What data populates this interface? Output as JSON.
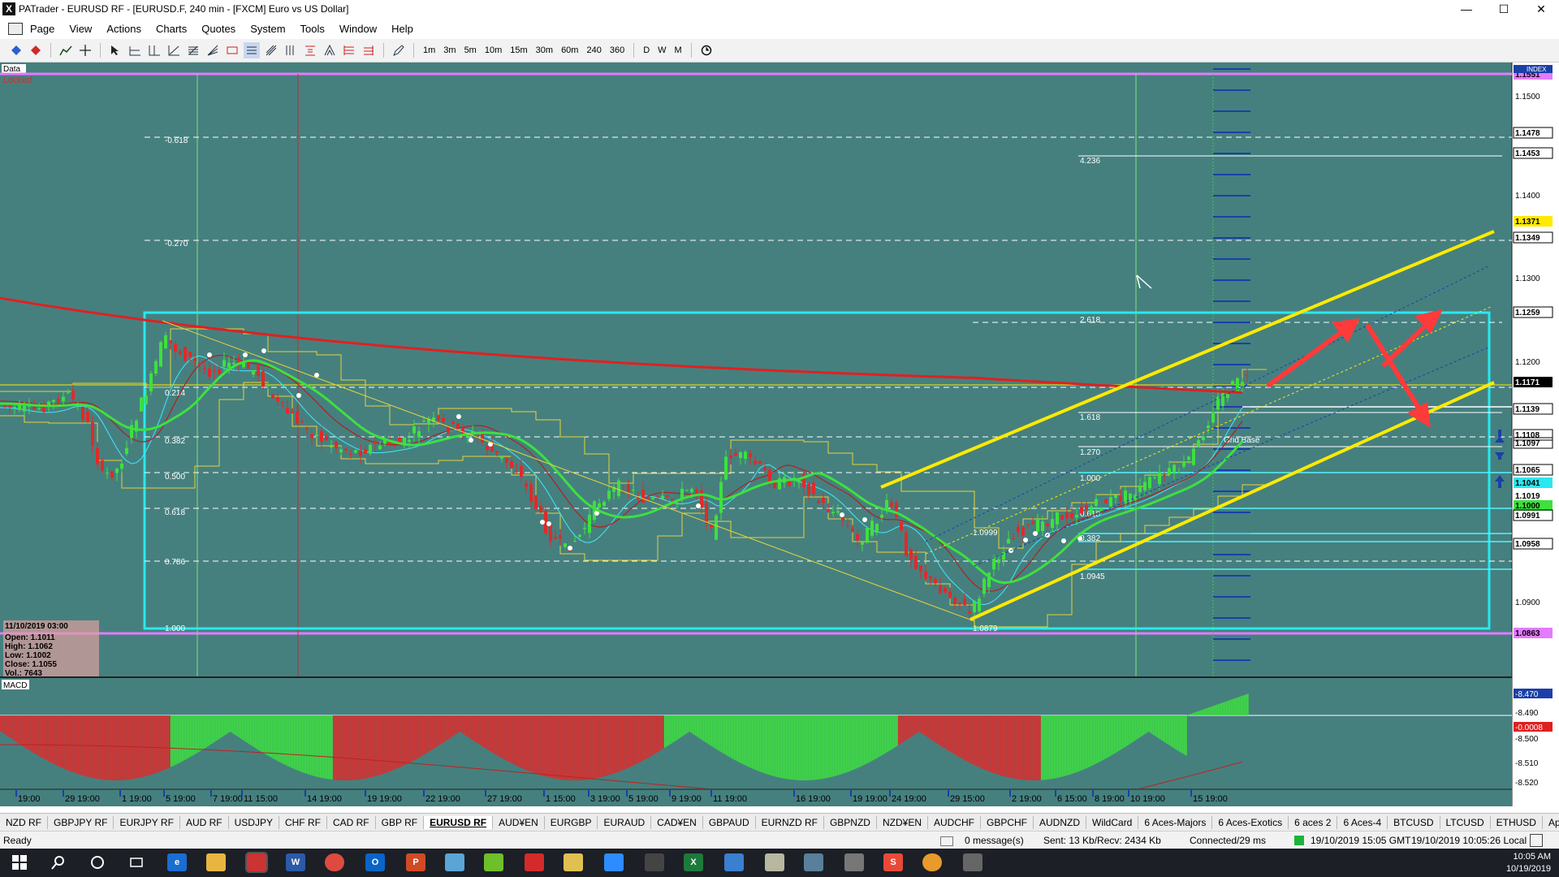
{
  "window": {
    "title": "PATrader - EURUSD RF - [EURUSD.F, 240 min - [FXCM] Euro vs US Dollar]",
    "app_icon_letter": "X",
    "controls": {
      "minimize": "—",
      "maximize": "☐",
      "close": "✕"
    },
    "mdi_controls": {
      "minimize": "–",
      "restore": "▭",
      "close": "✕"
    }
  },
  "menu": [
    "Page",
    "View",
    "Actions",
    "Charts",
    "Quotes",
    "System",
    "Tools",
    "Window",
    "Help"
  ],
  "toolbar": {
    "timeframes": [
      "1m",
      "3m",
      "5m",
      "10m",
      "15m",
      "30m",
      "60m",
      "240",
      "360",
      "D",
      "W",
      "M"
    ]
  },
  "chart": {
    "panel_label": "Data",
    "locked_label": "Locked",
    "index_label": "INDEX",
    "macd_label": "MACD",
    "price_axis": [
      "1.1551",
      "1.1500",
      "1.1478",
      "1.1453",
      "1.1400",
      "1.1371",
      "1.1349",
      "1.1300",
      "1.1259",
      "1.1200",
      "1.1171",
      "1.1139",
      "1.1108",
      "1.1097",
      "1.1065",
      "1.1041",
      "1.1019",
      "1.1000",
      "1.0991",
      "1.0958",
      "1.0900",
      "1.0863"
    ],
    "macd_axis": [
      "-8.490",
      "-0.0008",
      "-8.500",
      "-8.510",
      "-8.520"
    ],
    "macd_values": [
      "-8.470"
    ],
    "time_axis": [
      "19:00",
      "29 19:00",
      "1 19:00",
      "5 19:00",
      "7 19:00",
      "11 15:00",
      "14 19:00",
      "19 19:00",
      "22 19:00",
      "27 19:00",
      "1 15:00",
      "3 19:00",
      "5 19:00",
      "9 19:00",
      "11 19:00",
      "16 19:00",
      "19 19:00",
      "24 19:00",
      "29 15:00",
      "2 19:00",
      "6 15:00",
      "8 19:00",
      "10 19:00",
      "15 19:00"
    ],
    "fib_left": [
      "-0.618",
      "-0.270",
      "0.214",
      "0.382",
      "0.500",
      "0.618",
      "0.786",
      "1.000"
    ],
    "fib_right": [
      "4.236",
      "2.618",
      "1.618",
      "1.270",
      "1.000",
      "0.618",
      "0.382"
    ],
    "point_labels": [
      "1.0999",
      "1.0945",
      "1.0879"
    ],
    "grid_base_label": "Grid Base",
    "ohlc": {
      "date": "11/10/2019 03:00",
      "open": "Open: 1.1011",
      "high": "High: 1.1062",
      "low": "Low: 1.1002",
      "close": "Close: 1.1055",
      "vol": "Vol.: 7643"
    },
    "colors": {
      "background": "#45807f",
      "ema_red": "#e02020",
      "ema_green": "#3ee03e",
      "channel": "#ffea00",
      "box": "#29e8ef",
      "arrow": "#ff3a3a",
      "magenta": "#e27bff",
      "bull_candle": "#3ee03e",
      "bear_candle": "#e02a2a"
    }
  },
  "symbol_tabs": [
    "NZD RF",
    "GBPJPY RF",
    "EURJPY RF",
    "AUD RF",
    "USDJPY",
    "CHF RF",
    "CAD RF",
    "GBP RF",
    "EURUSD RF",
    "AUD¥EN",
    "EURGBP",
    "EURAUD",
    "CAD¥EN",
    "GBPAUD",
    "EURNZD RF",
    "GBPNZD",
    "NZD¥EN",
    "AUDCHF",
    "GBPCHF",
    "AUDNZD",
    "WildCard",
    "6 Aces-Majors",
    "6 Aces-Exotics",
    "6 aces 2",
    "6 Aces-4",
    "BTCUSD",
    "LTCUSD",
    "ETHUSD",
    "Apple"
  ],
  "active_tab": "EURUSD RF",
  "status": {
    "ready": "Ready",
    "messages": "0 message(s)",
    "sent": "Sent: 13 Kb/Recv: 2434 Kb",
    "connected": "Connected/29 ms",
    "gmt": "19/10/2019 15:05 GMT",
    "local": "19/10/2019 10:05:26 Local"
  },
  "taskbar": {
    "time": "10:05 AM",
    "date": "10/19/2019"
  }
}
